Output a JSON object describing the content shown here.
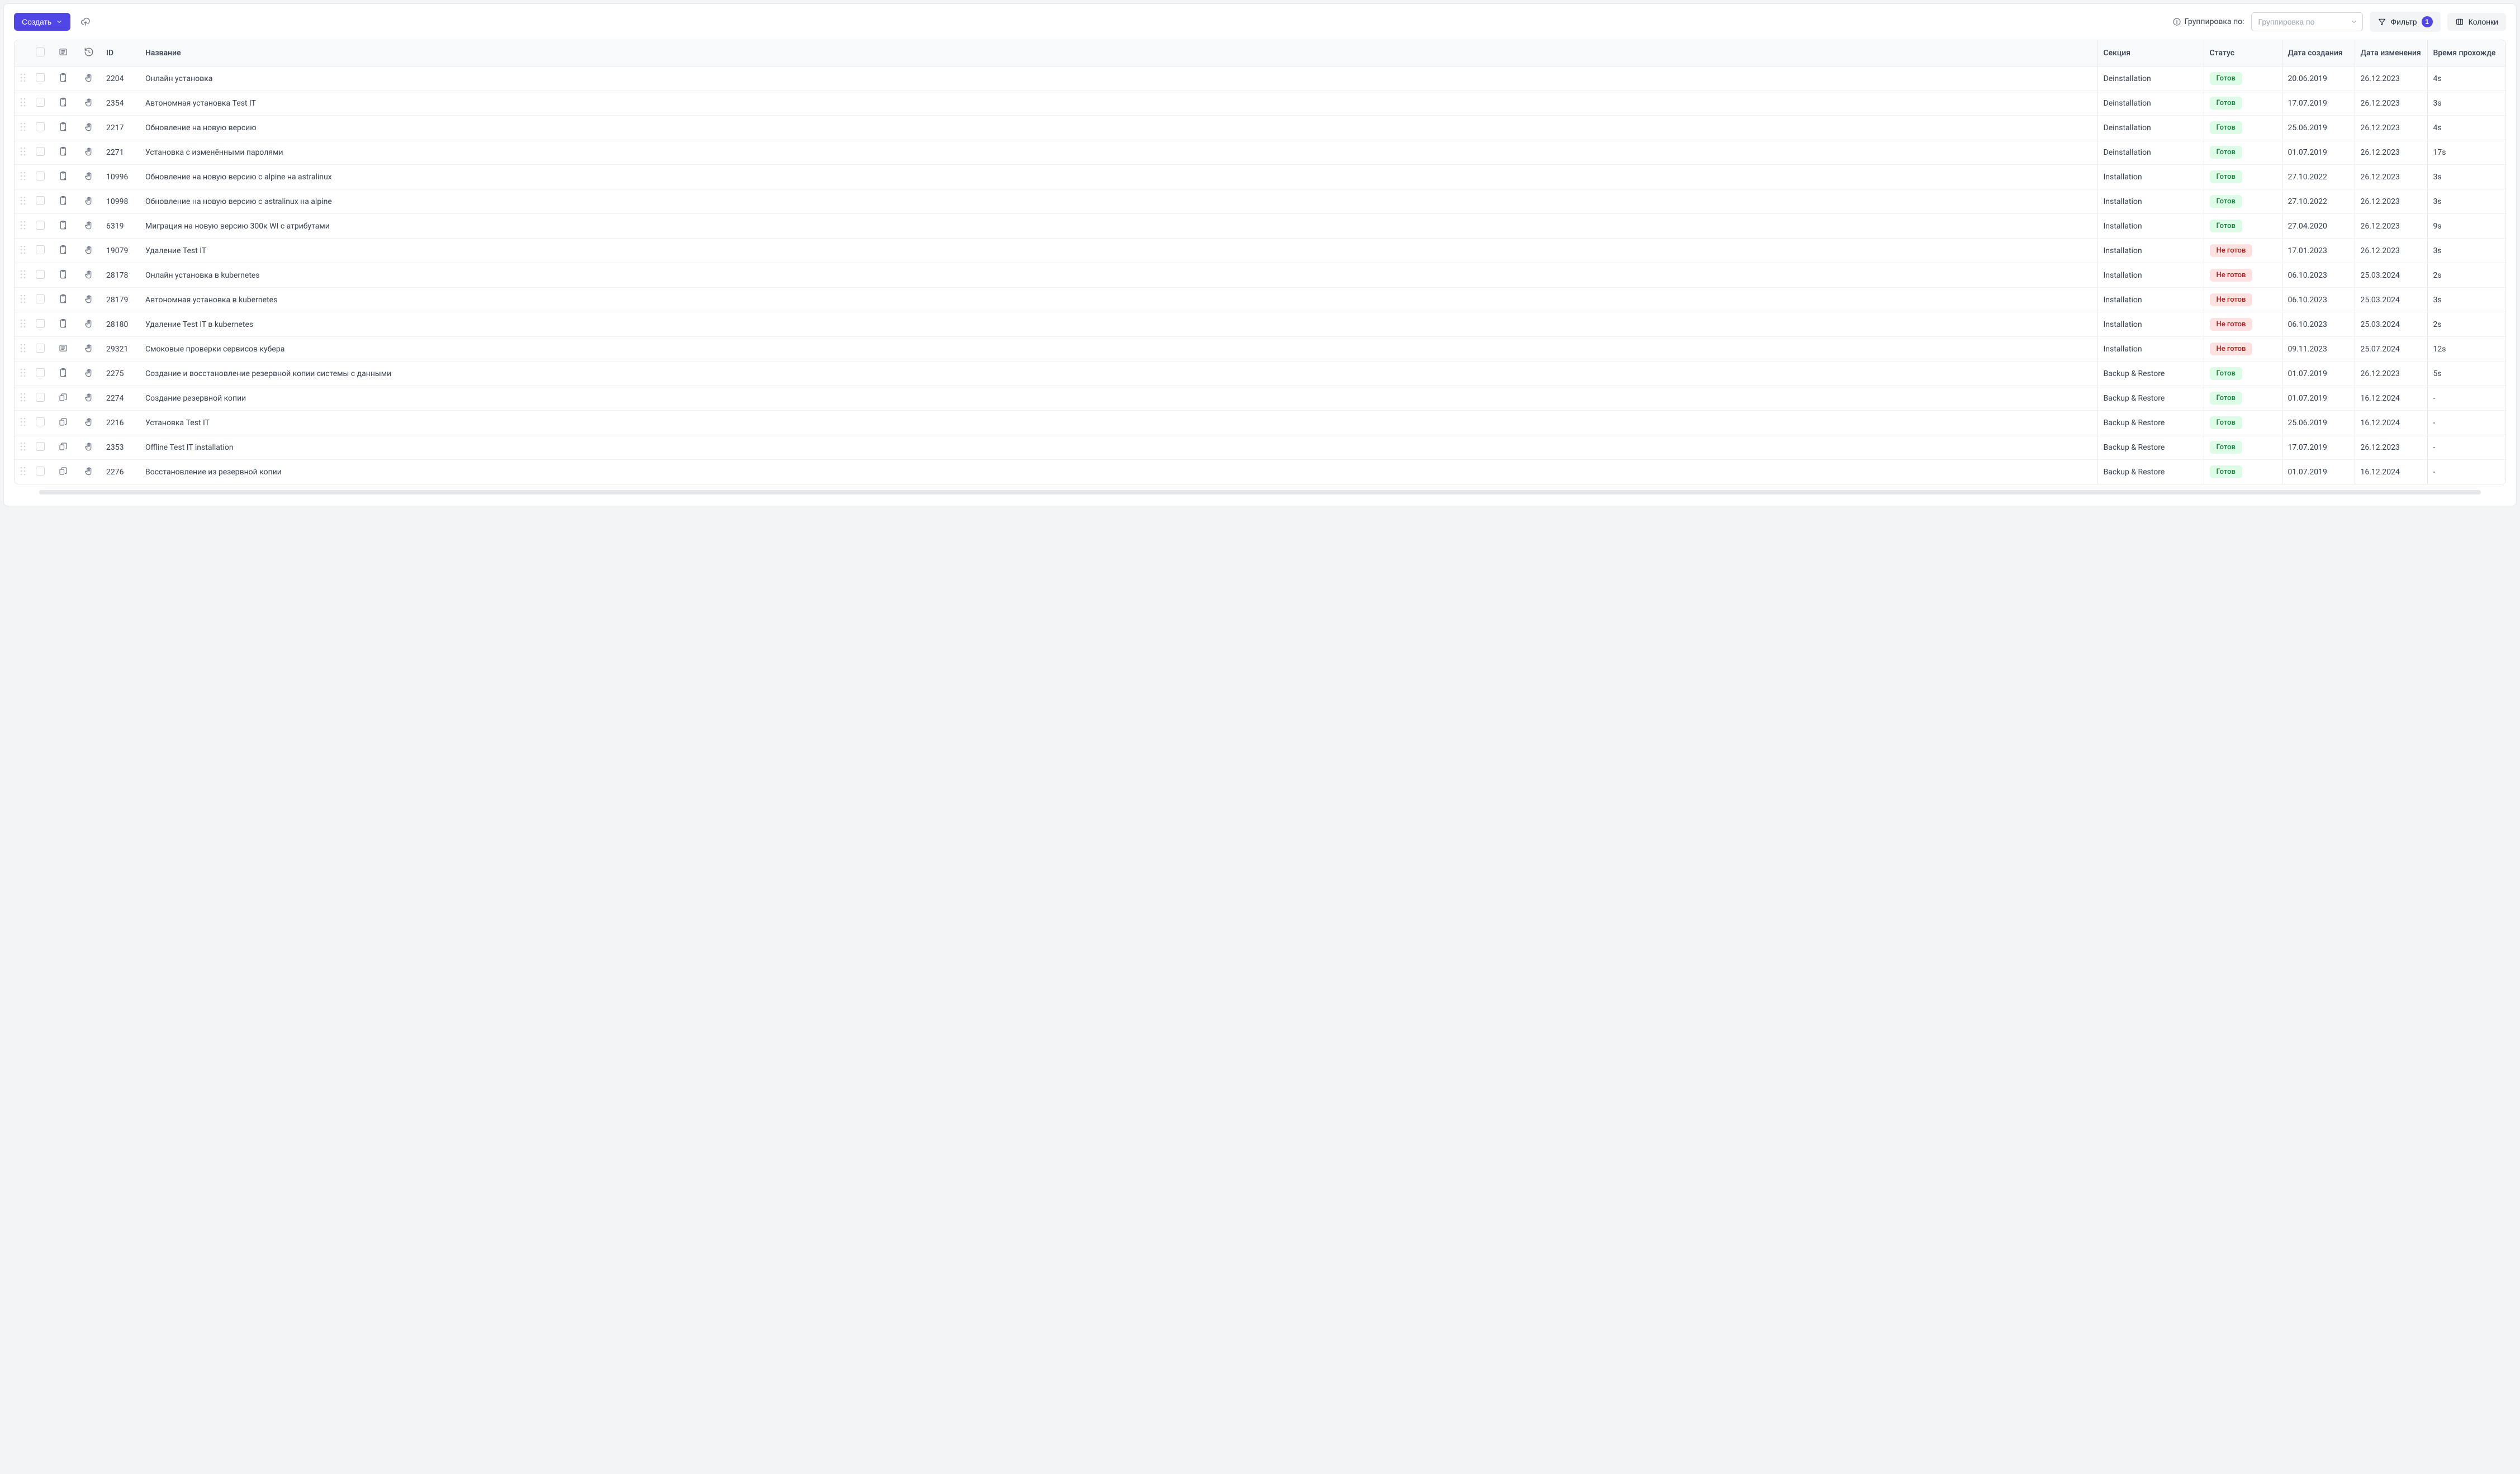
{
  "toolbar": {
    "create_label": "Создать",
    "group_by_label": "Группировка по:",
    "group_by_placeholder": "Группировка по",
    "filter_label": "Фильтр",
    "filter_count": "1",
    "columns_label": "Колонки"
  },
  "columns": {
    "id": "ID",
    "name": "Название",
    "section": "Секция",
    "status": "Статус",
    "created": "Дата создания",
    "modified": "Дата изменения",
    "duration": "Время прохожде"
  },
  "status_labels": {
    "ready": "Готов",
    "not_ready": "Не готов"
  },
  "rows": [
    {
      "type": "case",
      "id": "2204",
      "name": "Онлайн установка",
      "section": "Deinstallation",
      "status": "ready",
      "created": "20.06.2019",
      "modified": "26.12.2023",
      "duration": "4s"
    },
    {
      "type": "case",
      "id": "2354",
      "name": "Автономная установка Test IT",
      "section": "Deinstallation",
      "status": "ready",
      "created": "17.07.2019",
      "modified": "26.12.2023",
      "duration": "3s"
    },
    {
      "type": "case",
      "id": "2217",
      "name": "Обновление на новую версию",
      "section": "Deinstallation",
      "status": "ready",
      "created": "25.06.2019",
      "modified": "26.12.2023",
      "duration": "4s"
    },
    {
      "type": "case",
      "id": "2271",
      "name": "Установка с изменёнными паролями",
      "section": "Deinstallation",
      "status": "ready",
      "created": "01.07.2019",
      "modified": "26.12.2023",
      "duration": "17s"
    },
    {
      "type": "case",
      "id": "10996",
      "name": "Обновление на новую версию с alpine на astralinux",
      "section": "Installation",
      "status": "ready",
      "created": "27.10.2022",
      "modified": "26.12.2023",
      "duration": "3s"
    },
    {
      "type": "case",
      "id": "10998",
      "name": "Обновление на новую версию с astralinux на alpine",
      "section": "Installation",
      "status": "ready",
      "created": "27.10.2022",
      "modified": "26.12.2023",
      "duration": "3s"
    },
    {
      "type": "case",
      "id": "6319",
      "name": "Миграция на новую версию 300к WI с атрибутами",
      "section": "Installation",
      "status": "ready",
      "created": "27.04.2020",
      "modified": "26.12.2023",
      "duration": "9s"
    },
    {
      "type": "case",
      "id": "19079",
      "name": "Удаление Test IT",
      "section": "Installation",
      "status": "not_ready",
      "created": "17.01.2023",
      "modified": "26.12.2023",
      "duration": "3s"
    },
    {
      "type": "case",
      "id": "28178",
      "name": "Онлайн установка в kubernetes",
      "section": "Installation",
      "status": "not_ready",
      "created": "06.10.2023",
      "modified": "25.03.2024",
      "duration": "2s"
    },
    {
      "type": "case",
      "id": "28179",
      "name": "Автономная установка в kubernetes",
      "section": "Installation",
      "status": "not_ready",
      "created": "06.10.2023",
      "modified": "25.03.2024",
      "duration": "3s"
    },
    {
      "type": "case",
      "id": "28180",
      "name": "Удаление Test IT в kubernetes",
      "section": "Installation",
      "status": "not_ready",
      "created": "06.10.2023",
      "modified": "25.03.2024",
      "duration": "2s"
    },
    {
      "type": "list",
      "id": "29321",
      "name": "Смоковые проверки сервисов кубера",
      "section": "Installation",
      "status": "not_ready",
      "created": "09.11.2023",
      "modified": "25.07.2024",
      "duration": "12s"
    },
    {
      "type": "case",
      "id": "2275",
      "name": "Создание и восстановление резервной копии системы с данными",
      "section": "Backup & Restore",
      "status": "ready",
      "created": "01.07.2019",
      "modified": "26.12.2023",
      "duration": "5s"
    },
    {
      "type": "shared",
      "id": "2274",
      "name": "Создание резервной копии",
      "section": "Backup & Restore",
      "status": "ready",
      "created": "01.07.2019",
      "modified": "16.12.2024",
      "duration": "-"
    },
    {
      "type": "shared",
      "id": "2216",
      "name": "Установка Test IT",
      "section": "Backup & Restore",
      "status": "ready",
      "created": "25.06.2019",
      "modified": "16.12.2024",
      "duration": "-"
    },
    {
      "type": "shared",
      "id": "2353",
      "name": "Offline Test IT installation",
      "section": "Backup & Restore",
      "status": "ready",
      "created": "17.07.2019",
      "modified": "26.12.2023",
      "duration": "-"
    },
    {
      "type": "shared",
      "id": "2276",
      "name": "Восстановление из резервной копии",
      "section": "Backup & Restore",
      "status": "ready",
      "created": "01.07.2019",
      "modified": "16.12.2024",
      "duration": "-"
    }
  ]
}
